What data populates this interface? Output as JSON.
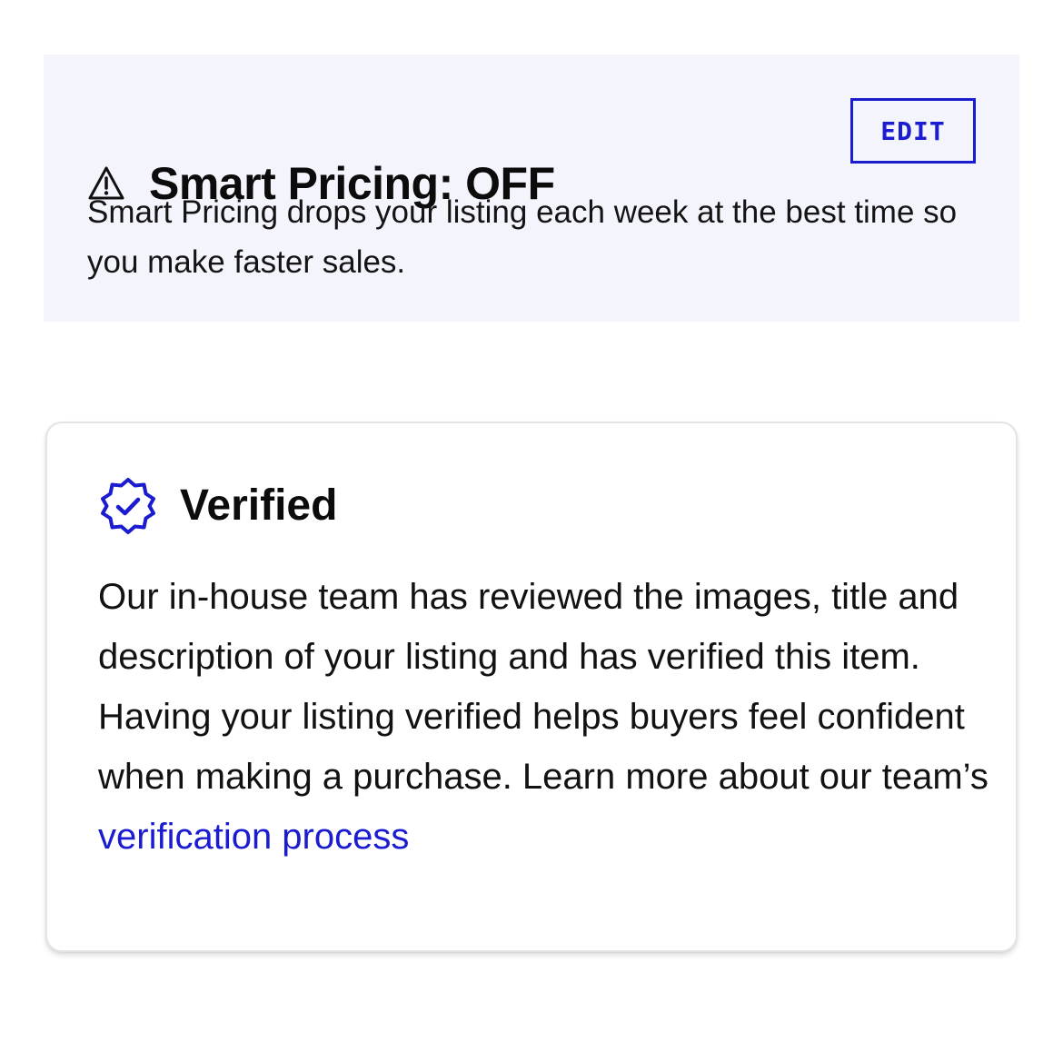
{
  "smart_pricing": {
    "title": "Smart Pricing: OFF",
    "edit_label": "EDIT",
    "description": "Smart Pricing drops your listing each week at the best time so you make faster sales.",
    "warning_icon": "warning-triangle-icon"
  },
  "verified": {
    "title": "Verified",
    "badge_icon": "verified-badge-icon",
    "description": "Our in-house team has reviewed the images, title and description of your listing and has verified this item. Having your listing verified helps buyers feel confident when making a purchase. Learn more about our team’s ",
    "link_text": "verification process"
  },
  "colors": {
    "accent": "#1b1bd0",
    "panel_background": "#f4f5fc",
    "text": "#111111"
  }
}
